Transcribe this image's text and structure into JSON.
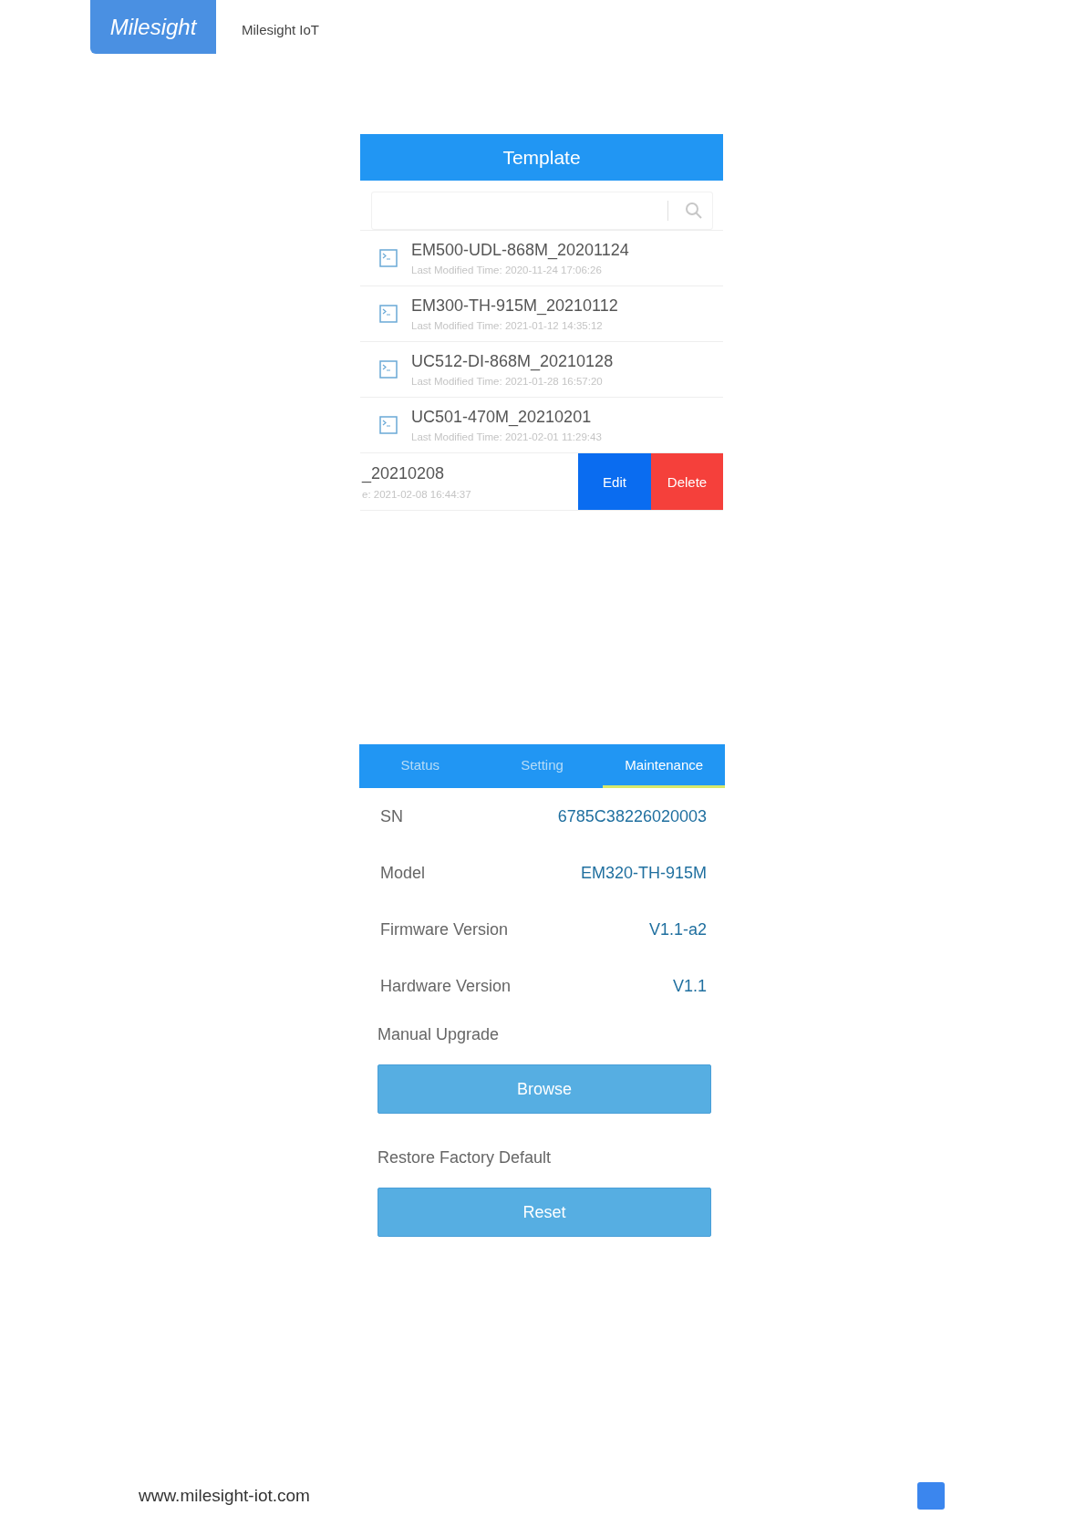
{
  "header": {
    "logo_text": "Milesight",
    "company": "Milesight IoT"
  },
  "template_screen": {
    "title": "Template",
    "items": [
      {
        "name": "EM500-UDL-868M_20201124",
        "time": "Last Modified Time: 2020-11-24 17:06:26"
      },
      {
        "name": "EM300-TH-915M_20210112",
        "time": "Last Modified Time: 2021-01-12 14:35:12"
      },
      {
        "name": "UC512-DI-868M_20210128",
        "time": "Last Modified Time: 2021-01-28 16:57:20"
      },
      {
        "name": "UC501-470M_20210201",
        "time": "Last Modified Time: 2021-02-01 11:29:43"
      }
    ],
    "swiped_item": {
      "name": "_20210208",
      "time": "e: 2021-02-08 16:44:37"
    },
    "actions": [
      {
        "label": "Edit",
        "kind": "edit"
      },
      {
        "label": "Delete",
        "kind": "delete"
      }
    ]
  },
  "maintenance_screen": {
    "tabs": [
      {
        "label": "Status",
        "selected": false
      },
      {
        "label": "Setting",
        "selected": false
      },
      {
        "label": "Maintenance",
        "selected": true
      }
    ],
    "info": [
      {
        "label": "SN",
        "value": "6785C38226020003"
      },
      {
        "label": "Model",
        "value": "EM320-TH-915M"
      },
      {
        "label": "Firmware Version",
        "value": "V1.1-a2"
      },
      {
        "label": "Hardware Version",
        "value": "V1.1"
      }
    ],
    "sections": [
      {
        "label": "Manual Upgrade",
        "button": "Browse"
      },
      {
        "label": "Restore Factory Default",
        "button": "Reset"
      }
    ]
  },
  "footer": {
    "url": "www.milesight-iot.com"
  }
}
